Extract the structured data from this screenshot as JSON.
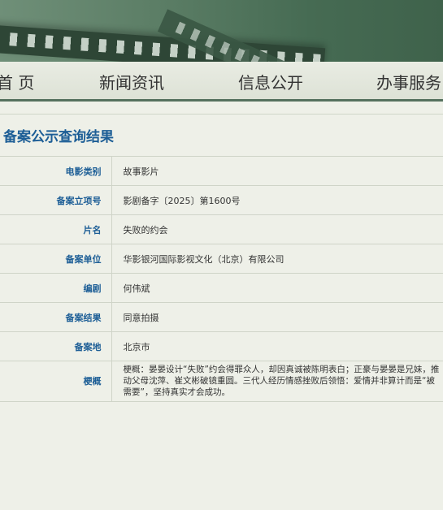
{
  "nav": {
    "items": [
      "首 页",
      "新闻资讯",
      "信息公开",
      "办事服务"
    ]
  },
  "section": {
    "title": "备案公示查询结果"
  },
  "record": {
    "rows": [
      {
        "label": "电影类别",
        "value": "故事影片"
      },
      {
        "label": "备案立项号",
        "value": "影剧备字〔2025〕第1600号"
      },
      {
        "label": "片名",
        "value": "失败的约会"
      },
      {
        "label": "备案单位",
        "value": "华影银河国际影视文化（北京）有限公司"
      },
      {
        "label": "编剧",
        "value": "何伟斌"
      },
      {
        "label": "备案结果",
        "value": "同意拍摄"
      },
      {
        "label": "备案地",
        "value": "北京市"
      },
      {
        "label": "梗概",
        "value": "梗概：晏晏设计“失败”约会得罪众人，却因真诚被陈明表白；正豪与晏晏是兄妹，推动父母沈萍、崔文彬破镜重圆。三代人经历情感挫败后领悟：爱情并非算计而是“被需要”，坚持真实才会成功。"
      }
    ]
  },
  "colors": {
    "accent": "#1d5e96",
    "nav_border": "#55715e",
    "background": "#eef0e8"
  }
}
